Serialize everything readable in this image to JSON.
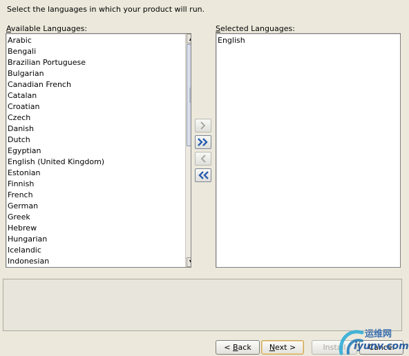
{
  "instruction": "Select the languages in which your product will run.",
  "available": {
    "label_mnemonic": "A",
    "label_rest": "vailable Languages:",
    "items": [
      "Arabic",
      "Bengali",
      "Brazilian Portuguese",
      "Bulgarian",
      "Canadian French",
      "Catalan",
      "Croatian",
      "Czech",
      "Danish",
      "Dutch",
      "Egyptian",
      "English (United Kingdom)",
      "Estonian",
      "Finnish",
      "French",
      "German",
      "Greek",
      "Hebrew",
      "Hungarian",
      "Icelandic",
      "Indonesian"
    ]
  },
  "selected": {
    "label_mnemonic": "S",
    "label_rest": "elected Languages:",
    "items": [
      "English"
    ]
  },
  "transfer": {
    "add_enabled": false,
    "add_all_enabled": true,
    "remove_enabled": false,
    "remove_all_enabled": true
  },
  "nav": {
    "back_pre": "< ",
    "back_mnemonic": "B",
    "back_rest": "ack",
    "next_mnemonic": "N",
    "next_rest": "ext >",
    "install": "Install",
    "cancel": "Cancel"
  },
  "watermark": {
    "line1": "运维网",
    "line2": "iyunv.com"
  },
  "colors": {
    "window_bg": "#ece9dc",
    "arrow_blue": "#2a5db0",
    "disabled_arrow": "#a9a9a3"
  }
}
